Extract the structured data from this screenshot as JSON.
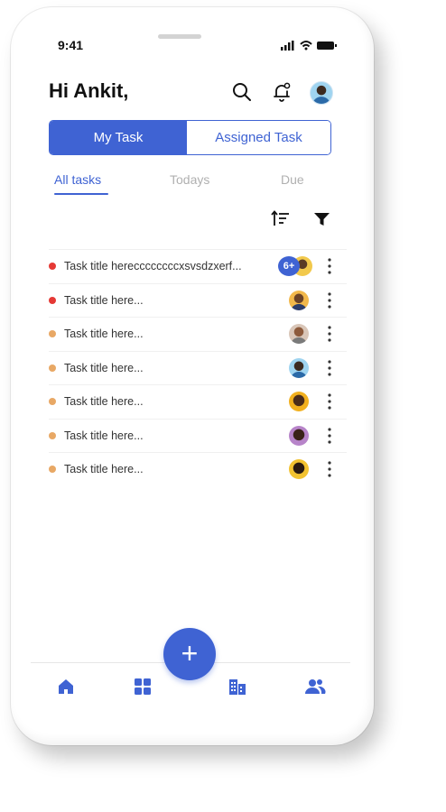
{
  "status_bar": {
    "time": "9:41"
  },
  "header": {
    "greeting": "Hi Ankit,"
  },
  "segment": {
    "my_task": "My Task",
    "assigned_task": "Assigned Task"
  },
  "tabs": [
    {
      "label": "All tasks",
      "active": true
    },
    {
      "label": "Todays",
      "active": false
    },
    {
      "label": "Due",
      "active": false
    }
  ],
  "tasks": [
    {
      "title": "Task title hereccccccccxsvsdzxerf...",
      "priority_color": "#e53935",
      "badge": "6+"
    },
    {
      "title": "Task title here...",
      "priority_color": "#e53935"
    },
    {
      "title": "Task title here...",
      "priority_color": "#e8a865"
    },
    {
      "title": "Task title here...",
      "priority_color": "#e8a865"
    },
    {
      "title": "Task title here...",
      "priority_color": "#e8a865"
    },
    {
      "title": "Task title here...",
      "priority_color": "#e8a865"
    },
    {
      "title": "Task title here...",
      "priority_color": "#e8a865"
    }
  ],
  "colors": {
    "accent": "#3f63d3",
    "high_priority": "#e53935",
    "medium_priority": "#e8a865"
  },
  "icons": {
    "header": [
      "search-icon",
      "notification-bell-icon",
      "user-avatar"
    ],
    "toolbar": [
      "sort-icon",
      "filter-icon"
    ],
    "bottom_nav": [
      "home-icon",
      "grid-icon",
      "buildings-icon",
      "users-icon"
    ],
    "fab": "plus-icon"
  },
  "fab": {
    "label": "+"
  }
}
